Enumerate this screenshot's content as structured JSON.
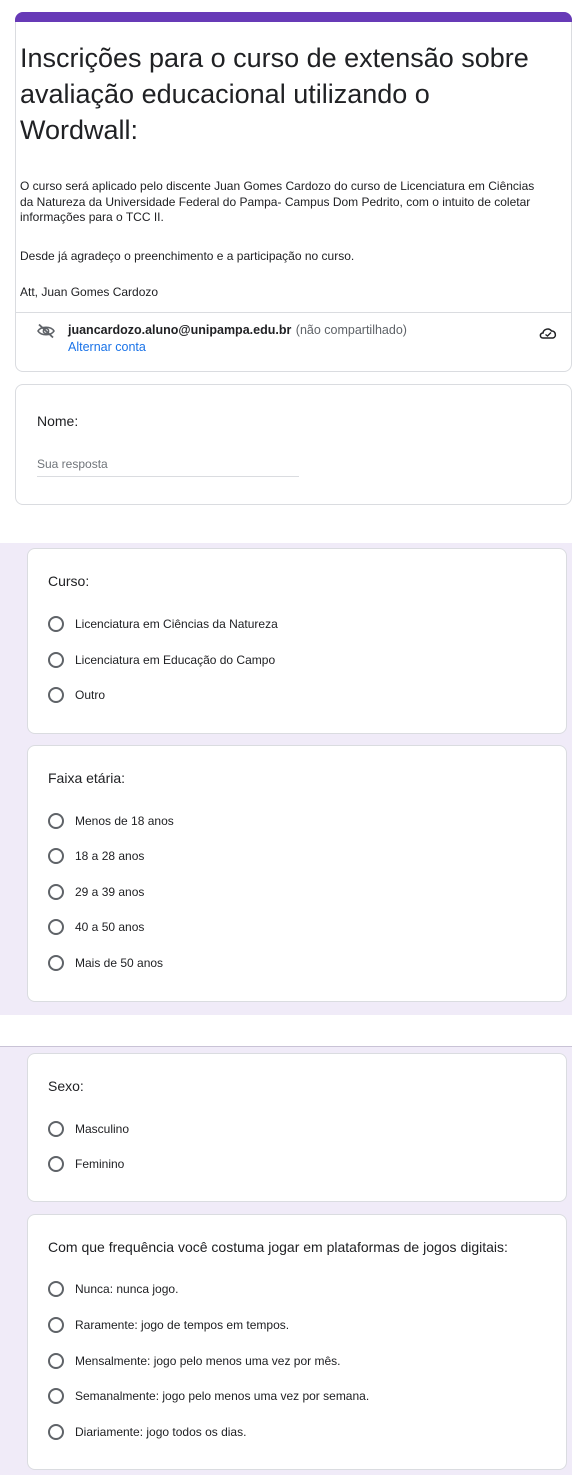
{
  "form": {
    "title": "Inscrições para o curso de extensão sobre avaliação educacional utilizando o Wordwall:",
    "description": [
      "O curso será aplicado pelo discente Juan Gomes Cardozo do curso de Licenciatura em Ciências da Natureza da Universidade Federal do Pampa- Campus Dom Pedrito, com o intuito de coletar informações para o TCC II.",
      "Desde já agradeço o preenchimento e a participação no curso.",
      "Att, Juan Gomes Cardozo"
    ],
    "account": {
      "email": "juancardozo.aluno@unipampa.edu.br",
      "note": "(não compartilhado)",
      "switch_label": "Alternar conta",
      "hidden_icon": "eye-off-icon",
      "cloud_icon": "cloud-saved-icon"
    }
  },
  "questions": {
    "nome": {
      "label": "Nome:",
      "placeholder": "Sua resposta"
    },
    "curso": {
      "label": "Curso:",
      "options": [
        "Licenciatura em Ciências da Natureza",
        "Licenciatura em Educação do Campo",
        "Outro"
      ]
    },
    "faixa": {
      "label": "Faixa etária:",
      "options": [
        "Menos de 18 anos",
        "18 a 28 anos",
        "29 a 39 anos",
        "40 a 50 anos",
        "Mais de 50 anos"
      ]
    },
    "sexo": {
      "label": "Sexo:",
      "options": [
        "Masculino",
        "Feminino"
      ]
    },
    "frequencia": {
      "label": "Com que frequência você costuma jogar em plataformas de jogos digitais:",
      "options": [
        "Nunca: nunca jogo.",
        "Raramente: jogo de tempos em tempos.",
        "Mensalmente: jogo pelo menos uma vez por mês.",
        "Semanalmente: jogo pelo menos uma vez por semana.",
        "Diariamente: jogo todos os dias."
      ]
    }
  },
  "colors": {
    "accent": "#673ab7",
    "background": "#f0ebf8",
    "link": "#1a73e8"
  }
}
